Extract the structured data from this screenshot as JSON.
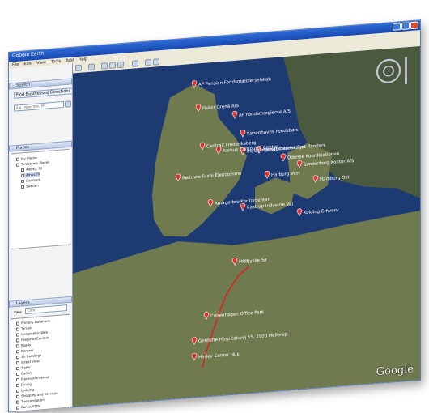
{
  "window": {
    "title": "Google Earth"
  },
  "menu": [
    "File",
    "Edit",
    "View",
    "Tools",
    "Add",
    "Help"
  ],
  "search": {
    "panel_title": "Search",
    "tab_fly": "Find Businesses",
    "tab_dir": "Directions",
    "query_placeholder": "e.g., New York, NY"
  },
  "places": {
    "panel_title": "Places",
    "items": [
      "My Places",
      "Temporary Places",
      "Ålborg, Til",
      "Århus Til",
      "Danmark",
      "Sweden"
    ]
  },
  "layers": {
    "panel_title": "Layers",
    "view_label": "View:",
    "view_value": "Core",
    "items": [
      "Primary Database",
      "Terrain",
      "Geographic Web",
      "Featured Content",
      "Roads",
      "Borders",
      "3D Buildings",
      "Street View",
      "Traffic",
      "Gallery",
      "Places of Interest",
      "Dining",
      "Lodging",
      "Shopping and Services",
      "Transportation",
      "Banks/ATMs"
    ]
  },
  "map": {
    "colors": {
      "sea": "#1e3a73",
      "land": "#6f7a4e",
      "sweden": "#4b5a3f",
      "route": "#e02020"
    },
    "labels": [
      "AP Pension Fondsmæglerselskab",
      "Fisker Grenå A/S",
      "AP Fondsmæglerne A/S",
      "Københavns Fondsbørs",
      "Centralt Frederiksberg",
      "Aarhus Computer Center",
      "Ingeniørhuset Odense Fyn",
      "Ejendomsselskabet Randers",
      "Odense Koordinationen",
      "Sønderborg Kontor A/S",
      "Rødovre Faste Ejendomme",
      "Harburg Vest",
      "Hamburg Ost",
      "Amagerbro Kontorcenter",
      "Kastrup Industrie Vej",
      "Kolding Erhverv",
      "Midtjyske Sø",
      "Copenhagen Office Park",
      "Gentofte Hospitalsvej 55, 2900 Hellerup",
      "Herlev Center Hus"
    ],
    "logo": "Google"
  }
}
